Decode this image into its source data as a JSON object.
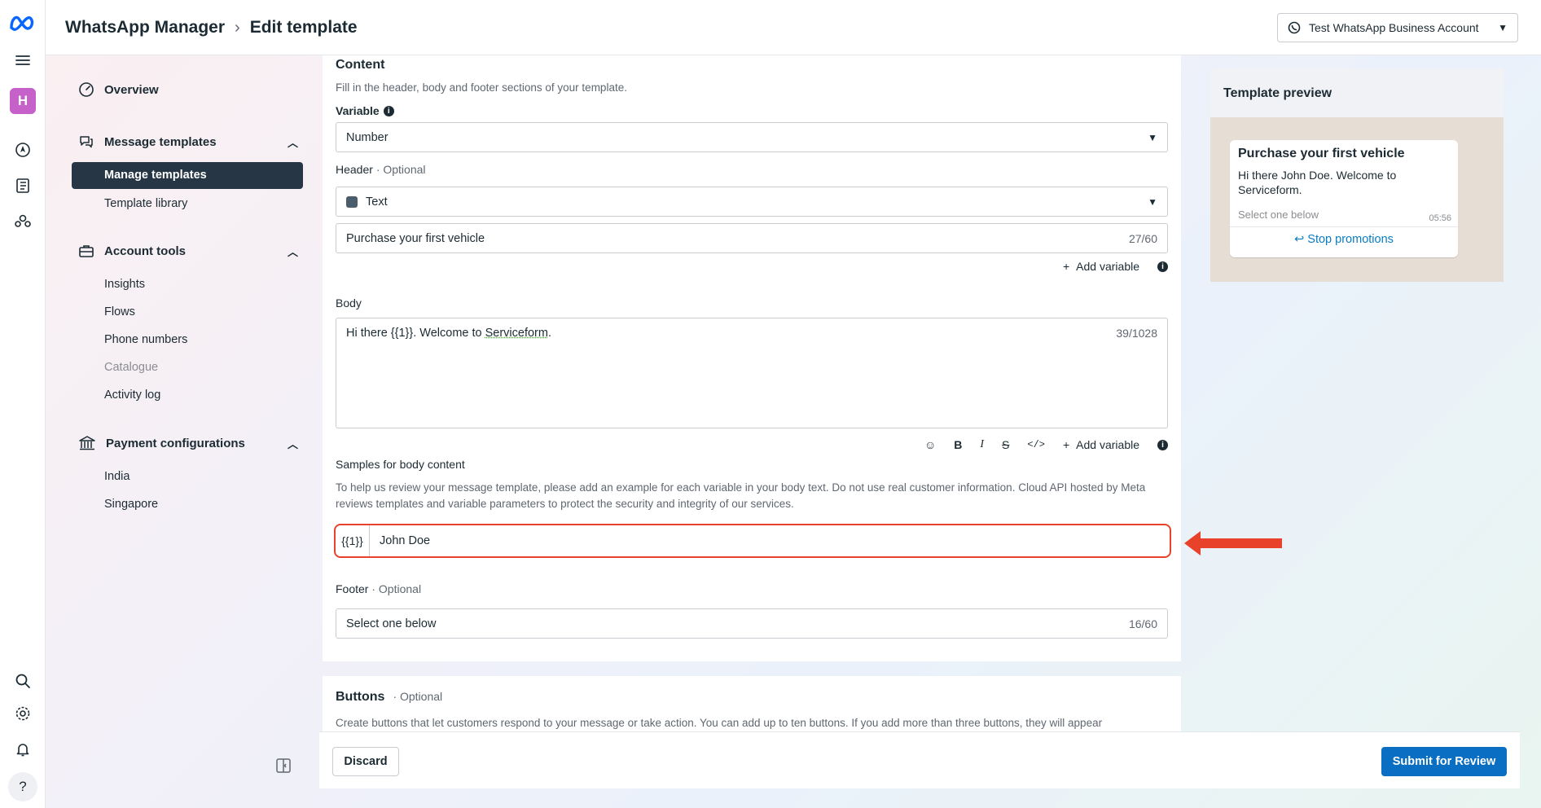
{
  "topbar": {
    "app_title": "WhatsApp Manager",
    "page_title": "Edit template",
    "account_selector": "Test WhatsApp Business Account"
  },
  "rail": {
    "avatar_letter": "H",
    "icons": [
      "meta-logo-icon",
      "menu-icon",
      "compass-icon",
      "catalog-icon",
      "people-icon",
      "search-icon",
      "gear-icon",
      "bell-icon",
      "help-icon"
    ]
  },
  "sidebar": {
    "overview": "Overview",
    "message_templates": {
      "label": "Message templates",
      "items": [
        "Manage templates",
        "Template library"
      ]
    },
    "account_tools": {
      "label": "Account tools",
      "items": [
        "Insights",
        "Flows",
        "Phone numbers",
        "Catalogue",
        "Activity log"
      ]
    },
    "payment_configurations": {
      "label": "Payment configurations",
      "items": [
        "India",
        "Singapore"
      ]
    }
  },
  "content": {
    "title": "Content",
    "subtitle": "Fill in the header, body and footer sections of your template.",
    "variable_label": "Variable",
    "variable_value": "Number",
    "header_label": "Header",
    "optional": "· Optional",
    "header_type": "Text",
    "header_text": "Purchase your first vehicle",
    "header_counter": "27/60",
    "add_variable": "Add variable",
    "body_label": "Body",
    "body_prefix": "Hi there {{1}}. Welcome to ",
    "body_link_word": "Serviceform",
    "body_suffix": ".",
    "body_counter": "39/1028",
    "samples_label": "Samples for body content",
    "samples_hint": "To help us review your message template, please add an example for each variable in your body text. Do not use real customer information. Cloud API hosted by Meta reviews templates and variable parameters to protect the security and integrity of our services.",
    "sample_var": "{{1}}",
    "sample_value": "John Doe",
    "footer_label": "Footer",
    "footer_text": "Select one below",
    "footer_counter": "16/60"
  },
  "buttons_section": {
    "title": "Buttons",
    "optional": "· Optional",
    "hint": "Create buttons that let customers respond to your message or take action. You can add up to ten buttons. If you add more than three buttons, they will appear"
  },
  "actions": {
    "discard": "Discard",
    "submit": "Submit for Review"
  },
  "preview": {
    "title": "Template preview",
    "bubble_title": "Purchase your first vehicle",
    "bubble_body": "Hi there John Doe. Welcome to Serviceform.",
    "bubble_footer": "Select one below",
    "time": "05:56",
    "quick_reply": "Stop promotions"
  },
  "colors": {
    "accent_blue": "#0a6fc2",
    "active_nav": "#263645",
    "highlight_red": "#e8432a",
    "link_blue": "#0a7cc1"
  }
}
